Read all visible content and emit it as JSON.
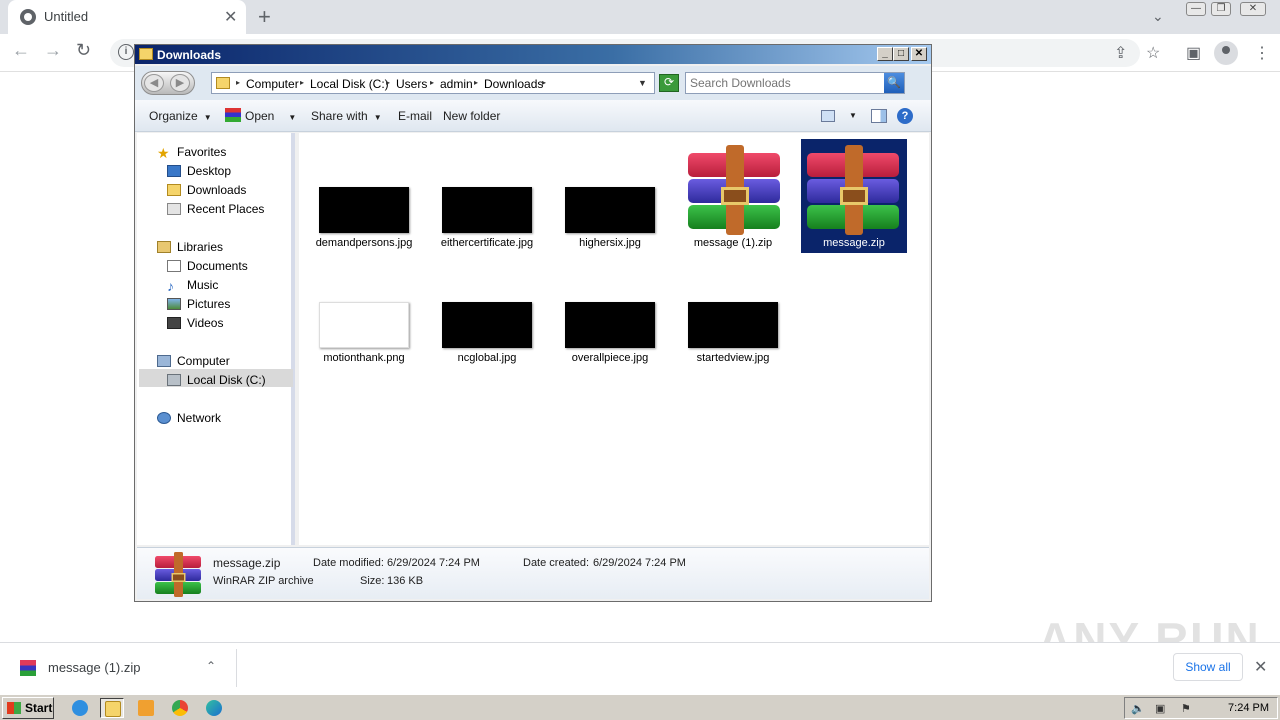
{
  "browser": {
    "tab_title": "Untitled",
    "tab_close": "✕",
    "new_tab": "+",
    "tab_search": "⌄",
    "win_minimize": "—",
    "win_restore": "❐",
    "win_close": "✕",
    "nav_back": "←",
    "nav_forward": "→",
    "nav_reload": "↻",
    "omnibox_info": "i",
    "share": "⇪",
    "bookmark": "☆",
    "sidepanel": "▣",
    "menu": "⋮"
  },
  "explorer": {
    "window_title": "Downloads",
    "caption_min": "_",
    "caption_max": "□",
    "caption_close": "✕",
    "nav_back": "◀",
    "nav_forward": "▶",
    "breadcrumbs": [
      "Computer",
      "Local Disk (C:)",
      "Users",
      "admin",
      "Downloads"
    ],
    "breadcrumb_sep": "▸",
    "address_dropdown": "▼",
    "refresh": "⟳",
    "search_placeholder": "Search Downloads",
    "search_icon": "🔍",
    "commands": {
      "organize": "Organize",
      "open": "Open",
      "share_with": "Share with",
      "email": "E-mail",
      "new_folder": "New folder",
      "caret": "▼",
      "help": "?"
    },
    "nav": {
      "favorites": "Favorites",
      "desktop": "Desktop",
      "downloads": "Downloads",
      "recent_places": "Recent Places",
      "libraries": "Libraries",
      "documents": "Documents",
      "music": "Music",
      "pictures": "Pictures",
      "videos": "Videos",
      "computer": "Computer",
      "local_disk": "Local Disk (C:)",
      "network": "Network"
    },
    "files": [
      {
        "name": "demandpersons.jpg",
        "type": "dark-image"
      },
      {
        "name": "eithercertificate.jpg",
        "type": "dark-image"
      },
      {
        "name": "highersix.jpg",
        "type": "dark-image"
      },
      {
        "name": "message (1).zip",
        "type": "winrar"
      },
      {
        "name": "message.zip",
        "type": "winrar",
        "selected": true
      },
      {
        "name": "motionthank.png",
        "type": "light-image"
      },
      {
        "name": "ncglobal.jpg",
        "type": "dark-image"
      },
      {
        "name": "overallpiece.jpg",
        "type": "dark-image"
      },
      {
        "name": "startedview.jpg",
        "type": "dark-image"
      }
    ],
    "details": {
      "name": "message.zip",
      "type": "WinRAR ZIP archive",
      "modified_label": "Date modified:",
      "modified_value": "6/29/2024 7:24 PM",
      "created_label": "Date created:",
      "created_value": "6/29/2024 7:24 PM",
      "size_label": "Size:",
      "size_value": "136 KB"
    }
  },
  "downloads_bar": {
    "item_name": "message (1).zip",
    "chevron": "⌃",
    "show_all": "Show all",
    "close": "✕"
  },
  "watermark": "ANY RUN",
  "taskbar": {
    "start": "Start",
    "clock": "7:24 PM"
  },
  "colors": {
    "explorer_title_start": "#0a246a",
    "selection": "#0a246a",
    "chrome_blue": "#1a73e8"
  }
}
